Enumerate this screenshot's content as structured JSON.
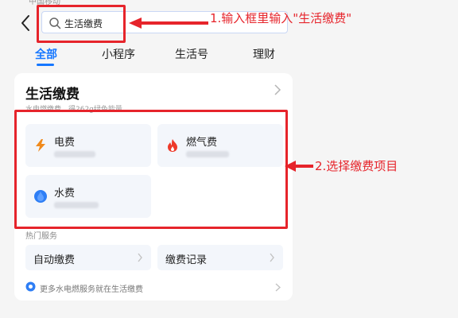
{
  "status_bar": {
    "text": "中国移动"
  },
  "search": {
    "query": "生活缴费"
  },
  "annotations": {
    "step1": "1.输入框里输入\"生活缴费\"",
    "step2": "2.选择缴费项目",
    "color": "#e6242b"
  },
  "tabs": [
    {
      "label": "全部",
      "active": true
    },
    {
      "label": "小程序",
      "active": false
    },
    {
      "label": "生活号",
      "active": false
    },
    {
      "label": "理财",
      "active": false
    }
  ],
  "card": {
    "title": "生活缴费",
    "subtitle": "水电燃缴费，得262g绿色能量",
    "items": [
      {
        "label": "电费",
        "icon": "lightning-icon"
      },
      {
        "label": "燃气费",
        "icon": "flame-icon"
      },
      {
        "label": "水费",
        "icon": "water-drop-icon"
      }
    ],
    "hot_label": "热门服务",
    "buttons": [
      {
        "label": "自动缴费"
      },
      {
        "label": "缴费记录"
      }
    ],
    "footer": "更多水电燃服务就在生活缴费"
  },
  "colors": {
    "accent": "#1677ff",
    "electric": "#f08a1c",
    "gas": "#ee3a2a",
    "water": "#2e7ef5"
  }
}
